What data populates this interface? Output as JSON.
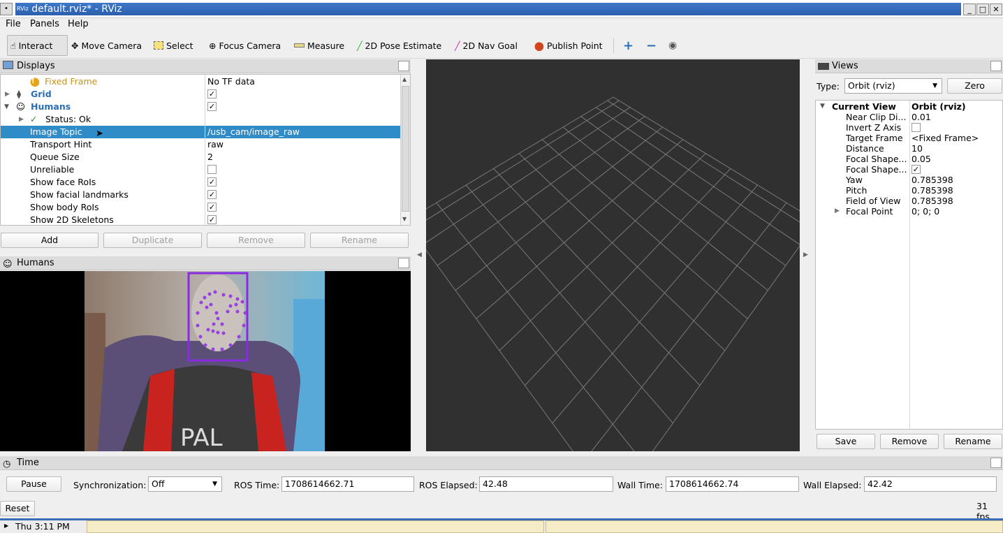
{
  "window": {
    "title": "default.rviz* - RViz",
    "app_icon": "RViz"
  },
  "menu": [
    "File",
    "Panels",
    "Help"
  ],
  "toolbar": {
    "tools": [
      {
        "label": "Interact",
        "icon": "hand-icon",
        "active": true
      },
      {
        "label": "Move Camera",
        "icon": "move-camera-icon"
      },
      {
        "label": "Select",
        "icon": "select-icon"
      },
      {
        "label": "Focus Camera",
        "icon": "focus-camera-icon"
      },
      {
        "label": "Measure",
        "icon": "ruler-icon"
      },
      {
        "label": "2D Pose Estimate",
        "icon": "green-arrow-icon"
      },
      {
        "label": "2D Nav Goal",
        "icon": "pink-arrow-icon"
      },
      {
        "label": "Publish Point",
        "icon": "map-pin-icon"
      }
    ],
    "extra_icons": [
      "plus-icon",
      "minus-icon",
      "eye-icon"
    ]
  },
  "displays": {
    "title": "Displays",
    "rows": [
      {
        "name": "Fixed Frame",
        "value": "No TF data",
        "status": "warning"
      },
      {
        "name": "Grid",
        "checked": true
      },
      {
        "name": "Humans",
        "checked": true
      },
      {
        "name": "Status: Ok"
      },
      {
        "name": "Image Topic",
        "value": "/usb_cam/image_raw",
        "selected": true
      },
      {
        "name": "Transport Hint",
        "value": "raw"
      },
      {
        "name": "Queue Size",
        "value": "2"
      },
      {
        "name": "Unreliable",
        "checked": false
      },
      {
        "name": "Show face RoIs",
        "checked": true
      },
      {
        "name": "Show facial landmarks",
        "checked": true
      },
      {
        "name": "Show body RoIs",
        "checked": true
      },
      {
        "name": "Show 2D Skeletons",
        "checked": true
      }
    ],
    "buttons": {
      "add": "Add",
      "duplicate": "Duplicate",
      "remove": "Remove",
      "rename": "Rename"
    }
  },
  "humans_panel": {
    "title": "Humans",
    "camera_text": "PAL"
  },
  "views": {
    "title": "Views",
    "type_label": "Type:",
    "type_value": "Orbit (rviz)",
    "zero": "Zero",
    "rows": [
      {
        "name": "Current View",
        "value": "Orbit (rviz)"
      },
      {
        "name": "Near Clip Di...",
        "value": "0.01"
      },
      {
        "name": "Invert Z Axis",
        "checked": false
      },
      {
        "name": "Target Frame",
        "value": "<Fixed Frame>"
      },
      {
        "name": "Distance",
        "value": "10"
      },
      {
        "name": "Focal Shape...",
        "value": "0.05"
      },
      {
        "name": "Focal Shape...",
        "checked": true
      },
      {
        "name": "Yaw",
        "value": "0.785398"
      },
      {
        "name": "Pitch",
        "value": "0.785398"
      },
      {
        "name": "Field of View",
        "value": "0.785398"
      },
      {
        "name": "Focal Point",
        "value": "0; 0; 0"
      }
    ],
    "buttons": {
      "save": "Save",
      "remove": "Remove",
      "rename": "Rename"
    }
  },
  "time": {
    "title": "Time",
    "pause": "Pause",
    "sync_label": "Synchronization:",
    "sync_value": "Off",
    "ros_time_label": "ROS Time:",
    "ros_time": "1708614662.71",
    "ros_elapsed_label": "ROS Elapsed:",
    "ros_elapsed": "42.48",
    "wall_time_label": "Wall Time:",
    "wall_time": "1708614662.74",
    "wall_elapsed_label": "Wall Elapsed:",
    "wall_elapsed": "42.42",
    "reset": "Reset",
    "fps": "31 fps"
  },
  "taskbar": {
    "clock": "Thu 3:11 PM"
  },
  "colors": {
    "selection": "#308cc6",
    "viewport": "#303030",
    "grid": "#7a7a7a",
    "face_box": "#8a2be2",
    "accent_blue": "#2a6fb5"
  }
}
